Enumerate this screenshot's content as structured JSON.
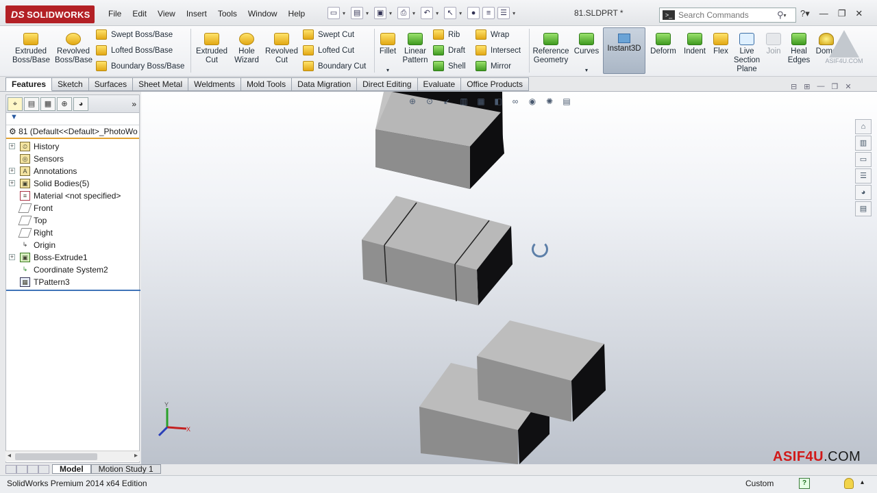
{
  "menu": [
    "File",
    "Edit",
    "View",
    "Insert",
    "Tools",
    "Window",
    "Help"
  ],
  "app": {
    "logo": "SOLIDWORKS",
    "document_title": "81.SLDPRT *"
  },
  "search": {
    "placeholder": "Search Commands"
  },
  "commands": {
    "extruded_boss": "Extruded Boss/Base",
    "revolved_boss": "Revolved Boss/Base",
    "swept_boss": "Swept Boss/Base",
    "lofted_boss": "Lofted Boss/Base",
    "boundary_boss": "Boundary Boss/Base",
    "extruded_cut": "Extruded Cut",
    "hole_wizard": "Hole Wizard",
    "revolved_cut": "Revolved Cut",
    "swept_cut": "Swept Cut",
    "lofted_cut": "Lofted Cut",
    "boundary_cut": "Boundary Cut",
    "fillet": "Fillet",
    "linear_pattern": "Linear Pattern",
    "rib": "Rib",
    "draft": "Draft",
    "shell": "Shell",
    "wrap": "Wrap",
    "intersect": "Intersect",
    "mirror": "Mirror",
    "reference_geometry": "Reference Geometry",
    "curves": "Curves",
    "instant3d": "Instant3D",
    "deform": "Deform",
    "indent": "Indent",
    "flex": "Flex",
    "live_section_plane": "Live Section Plane",
    "join": "Join",
    "heal_edges": "Heal Edges",
    "dome": "Dome"
  },
  "tabs": [
    "Features",
    "Sketch",
    "Surfaces",
    "Sheet Metal",
    "Weldments",
    "Mold Tools",
    "Data Migration",
    "Direct Editing",
    "Evaluate",
    "Office Products"
  ],
  "tree": {
    "root": "81  (Default<<Default>_PhotoWo",
    "items": [
      {
        "label": "History",
        "expandable": true
      },
      {
        "label": "Sensors",
        "expandable": false
      },
      {
        "label": "Annotations",
        "expandable": true
      },
      {
        "label": "Solid Bodies(5)",
        "expandable": true
      },
      {
        "label": "Material <not specified>",
        "expandable": false
      },
      {
        "label": "Front",
        "expandable": false
      },
      {
        "label": "Top",
        "expandable": false
      },
      {
        "label": "Right",
        "expandable": false
      },
      {
        "label": "Origin",
        "expandable": false
      },
      {
        "label": "Boss-Extrude1",
        "expandable": true
      },
      {
        "label": "Coordinate System2",
        "expandable": false
      },
      {
        "label": "TPattern3",
        "expandable": false
      }
    ]
  },
  "bottom_tabs": [
    "Model",
    "Motion Study 1"
  ],
  "status": {
    "text": "SolidWorks Premium 2014 x64 Edition",
    "units": "Custom"
  },
  "brand": {
    "main": "ASIF4U",
    "suffix": ".COM"
  },
  "watermark": "ASIF4U.COM",
  "triad": {
    "x": "X",
    "y": "Y"
  },
  "colors": {
    "logo_red": "#b32025",
    "brand_red": "#d11818",
    "active_tab": "#ffffff",
    "tree_highlight": "#e2a12f"
  }
}
